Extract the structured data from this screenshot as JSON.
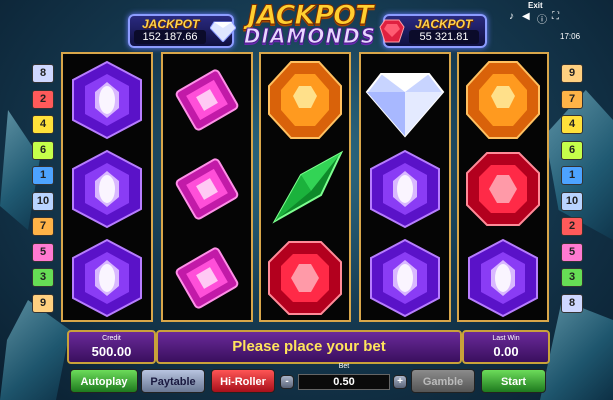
{
  "jackpot_left": {
    "title": "JACKPOT",
    "value": "152 187.66"
  },
  "jackpot_right": {
    "title": "JACKPOT",
    "value": "55 321.81"
  },
  "logo": {
    "line1": "JACKPOT",
    "line2": "DIAMONDS"
  },
  "topbar": {
    "exit_label": "Exit",
    "time": "17:06",
    "music_icon": "music-note-icon",
    "sound_icon": "speaker-icon",
    "info_icon": "info-icon",
    "fullscreen_icon": "fullscreen-icon"
  },
  "paylines_left": [
    "8",
    "2",
    "4",
    "6",
    "1",
    "10",
    "7",
    "5",
    "3",
    "9"
  ],
  "paylines_right": [
    "9",
    "7",
    "4",
    "6",
    "1",
    "10",
    "2",
    "5",
    "3",
    "8"
  ],
  "payline_colors": {
    "1": "#4da3ff",
    "2": "#ff5a5a",
    "3": "#66dd55",
    "4": "#ffe13a",
    "5": "#ff7ad1",
    "6": "#c6ff4a",
    "7": "#ffb347",
    "8": "#cfd7ff",
    "9": "#ffd080",
    "10": "#b9d4ff"
  },
  "reels": [
    [
      "purple-hexagon-gem",
      "purple-hexagon-gem",
      "purple-hexagon-gem"
    ],
    [
      "pink-rectangle-gem",
      "pink-rectangle-gem",
      "pink-rectangle-gem"
    ],
    [
      "orange-hexagon-gem",
      "green-kite-gem",
      "red-octagon-gem"
    ],
    [
      "white-diamond",
      "purple-hexagon-gem",
      "purple-hexagon-gem"
    ],
    [
      "orange-hexagon-gem",
      "red-octagon-gem",
      "purple-hexagon-gem"
    ]
  ],
  "credit": {
    "label": "Credit",
    "value": "500.00"
  },
  "message": "Please place your bet",
  "last_win": {
    "label": "Last Win",
    "value": "0.00"
  },
  "bet": {
    "label": "Bet",
    "value": "0.50",
    "minus": "-",
    "plus": "+"
  },
  "buttons": {
    "autoplay": "Autoplay",
    "paytable": "Paytable",
    "hiroller": "Hi-Roller",
    "gamble": "Gamble",
    "start": "Start"
  }
}
